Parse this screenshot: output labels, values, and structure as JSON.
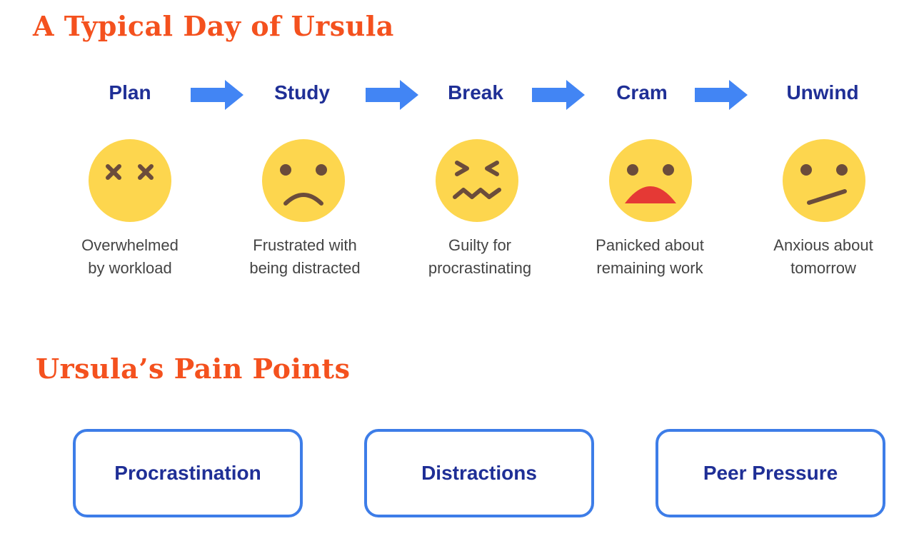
{
  "titles": {
    "day": "A Typical Day of Ursula",
    "pain": "Ursula’s Pain Points"
  },
  "stages": [
    {
      "title": "Plan",
      "line1": "Overwhelmed",
      "line2": "by workload",
      "face": "dizzy-face-icon"
    },
    {
      "title": "Study",
      "line1": "Frustrated with",
      "line2": "being distracted",
      "face": "frowning-face-icon"
    },
    {
      "title": "Break",
      "line1": "Guilty for",
      "line2": "procrastinating",
      "face": "confounded-face-icon"
    },
    {
      "title": "Cram",
      "line1": "Panicked about",
      "line2": "remaining work",
      "face": "anguished-face-icon"
    },
    {
      "title": "Unwind",
      "line1": "Anxious about",
      "line2": "tomorrow",
      "face": "confused-face-icon"
    }
  ],
  "pain_points": [
    "Procrastination",
    "Distractions",
    "Peer Pressure"
  ],
  "colors": {
    "heading": "#f4511e",
    "stage_text": "#1f2f96",
    "arrow": "#4285f4",
    "face": "#fdd64e",
    "face_features": "#6b4c3b",
    "mouth_open": "#e53935",
    "box_border": "#3d7de8"
  }
}
